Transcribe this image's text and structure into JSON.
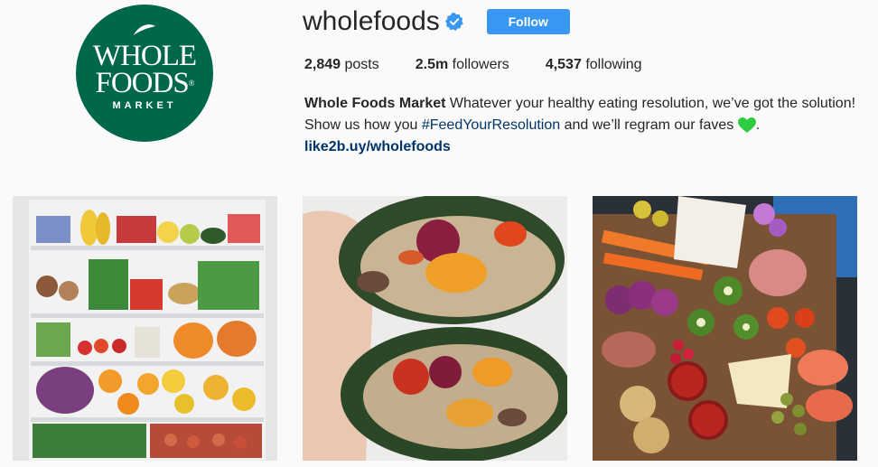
{
  "profile": {
    "username": "wholefoods",
    "follow_label": "Follow",
    "stats": {
      "posts_count": "2,849",
      "posts_label": "posts",
      "followers_count": "2.5m",
      "followers_label": "followers",
      "following_count": "4,537",
      "following_label": "following"
    },
    "bio": {
      "name": "Whole Foods Market",
      "line1_text": " Whatever your healthy eating resolution, we’ve got the solution!",
      "line2_pre": "Show us how you ",
      "hashtag": "#FeedYourResolution",
      "line2_post": " and we’ll regram our faves ",
      "line2_end": ".",
      "link": "like2b.uy/wholefoods"
    }
  },
  "logo": {
    "line1": "WHOLE",
    "line2": "FOODS",
    "line3": "MARKET",
    "reg_mark": "®"
  },
  "colors": {
    "brand_green": "#00674b",
    "follow_blue": "#3897f0",
    "link_blue": "#003569",
    "heart_green": "#2ecc40"
  },
  "icons": {
    "verified": "verified-badge-icon",
    "heart": "green-heart-icon"
  },
  "photos": [
    {
      "subject": "fridge"
    },
    {
      "subject": "wraps"
    },
    {
      "subject": "charcuterie"
    }
  ]
}
